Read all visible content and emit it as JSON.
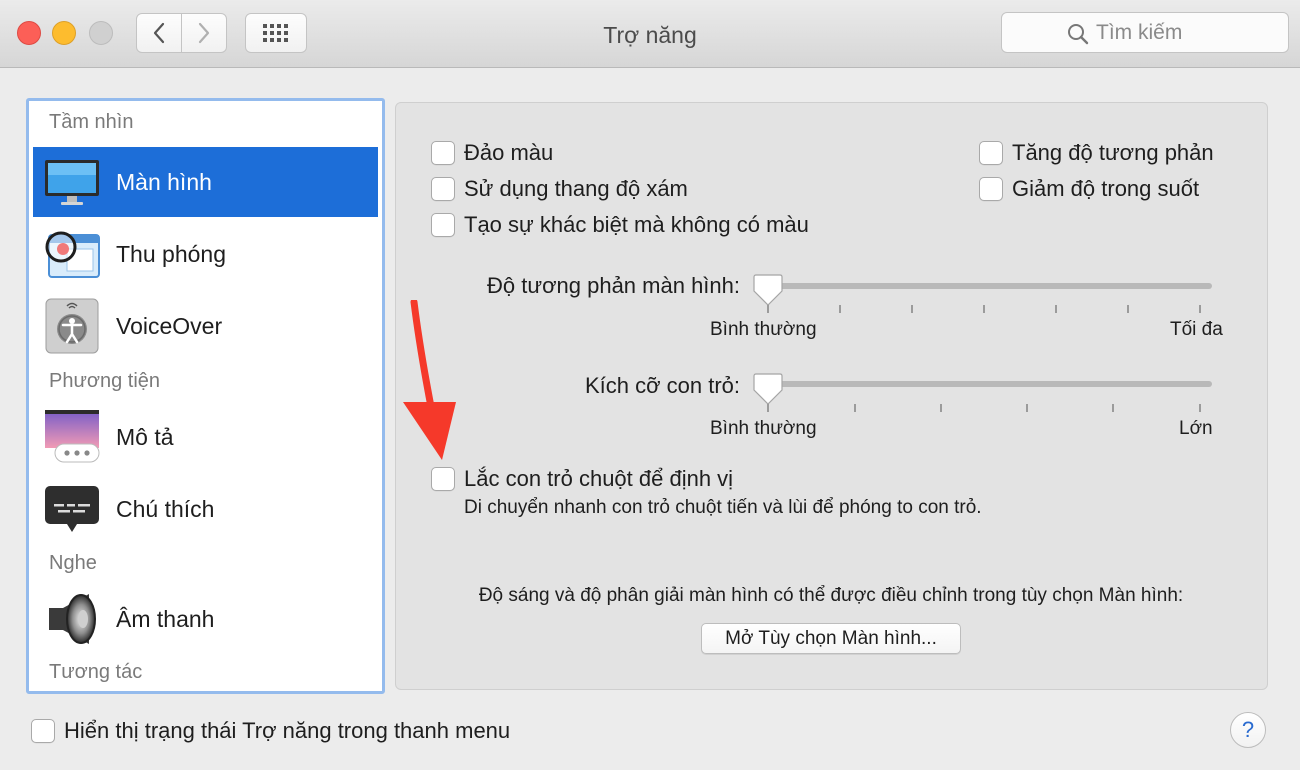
{
  "window": {
    "title": "Trợ năng",
    "search_placeholder": "Tìm kiếm"
  },
  "toolbar": {
    "back_icon": "chevron-left-icon",
    "forward_icon": "chevron-right-icon",
    "grid_icon": "grid-icon",
    "search_icon": "magnifier-icon"
  },
  "sidebar": {
    "headers": [
      "Tầm nhìn",
      "Phương tiện",
      "Nghe",
      "Tương tác"
    ],
    "items": [
      {
        "label": "Màn hình",
        "icon": "display-icon",
        "selected": true
      },
      {
        "label": "Thu phóng",
        "icon": "zoom-icon",
        "selected": false
      },
      {
        "label": "VoiceOver",
        "icon": "voiceover-icon",
        "selected": false
      },
      {
        "label": "Mô tả",
        "icon": "descriptions-icon",
        "selected": false
      },
      {
        "label": "Chú thích",
        "icon": "captions-icon",
        "selected": false
      },
      {
        "label": "Âm thanh",
        "icon": "speaker-icon",
        "selected": false
      }
    ]
  },
  "options": {
    "invert_colors": "Đảo màu",
    "grayscale": "Sử dụng thang độ xám",
    "differentiate": "Tạo sự khác biệt mà không có màu",
    "increase_contrast": "Tăng độ tương phản",
    "reduce_transparency": "Giảm độ trong suốt"
  },
  "contrast_slider": {
    "label": "Độ tương phản màn hình:",
    "min_label": "Bình thường",
    "max_label": "Tối đa",
    "value": 0
  },
  "cursor_slider": {
    "label": "Kích cỡ con trỏ:",
    "min_label": "Bình thường",
    "max_label": "Lớn",
    "value": 0
  },
  "shake": {
    "label": "Lắc con trỏ chuột để định vị",
    "description": "Di chuyển nhanh con trỏ chuột tiến và lùi để phóng to con trỏ."
  },
  "display_note": "Độ sáng và độ phân giải màn hình có thể được điều chỉnh trong tùy chọn Màn hình:",
  "open_display_button": "Mở Tùy chọn Màn hình...",
  "footer": {
    "show_status": "Hiển thị trạng thái Trợ năng trong thanh menu",
    "help": "?"
  },
  "colors": {
    "selection": "#1d6ed8",
    "annotation_arrow": "#f5392a"
  }
}
